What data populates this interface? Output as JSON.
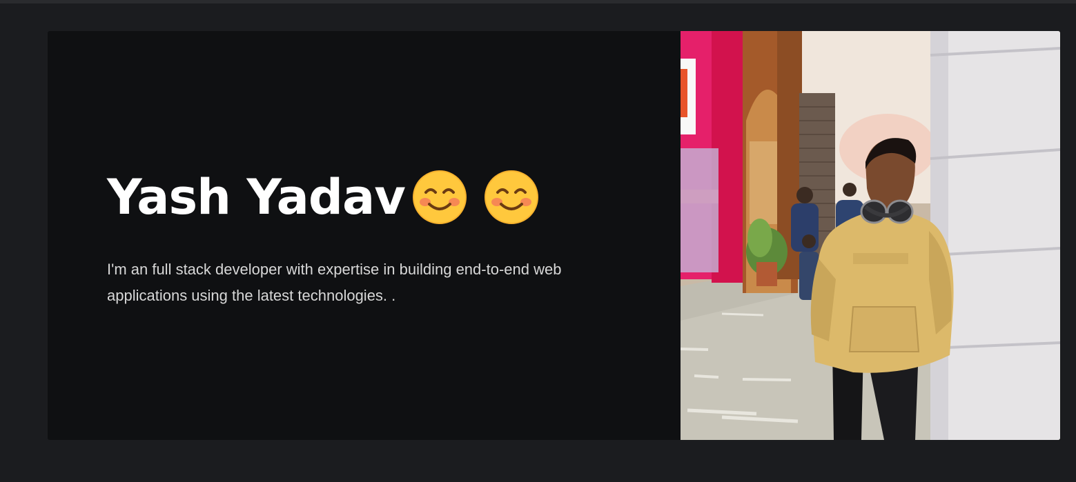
{
  "hero": {
    "name": "Yash Yadav",
    "emojis": [
      "smiling-face-emoji",
      "smiling-face-emoji"
    ],
    "bio": "I'm an full stack developer with expertise in building end-to-end web applications using the latest technologies. ."
  },
  "colors": {
    "page_bg": "#1b1c1f",
    "card_bg": "#0f1012",
    "title": "#ffffff",
    "text": "#d8d8d8"
  }
}
